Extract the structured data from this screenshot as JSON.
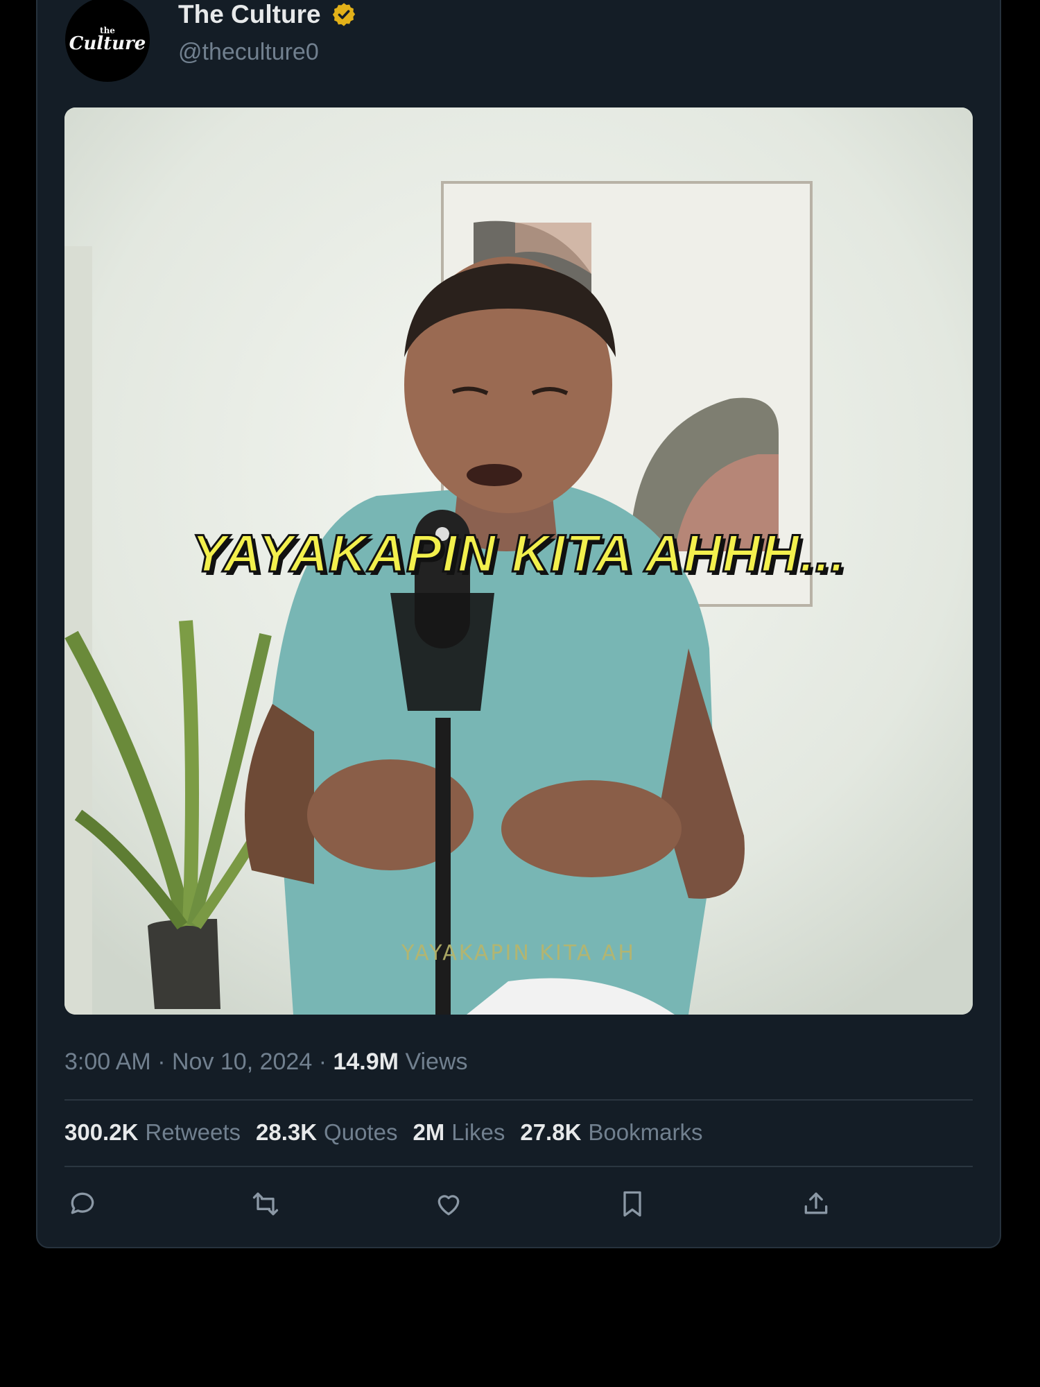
{
  "tweet": {
    "author": {
      "display_name": "The Culture",
      "handle": "@theculture0",
      "avatar_text_top": "the",
      "avatar_text_main": "Culture",
      "verified_badge_icon": "verified-badge-icon",
      "verified_color": "#e2b119"
    },
    "media": {
      "caption_main": "YAYAKAPIN KITA AHHH...",
      "caption_sub": "YAYAKAPIN KITA AH"
    },
    "meta": {
      "time": "3:00 AM",
      "date": "Nov 10, 2024",
      "separator": "·",
      "views_count": "14.9M",
      "views_label": "Views"
    },
    "stats": [
      {
        "count": "300.2K",
        "label": "Retweets"
      },
      {
        "count": "28.3K",
        "label": "Quotes"
      },
      {
        "count": "2M",
        "label": "Likes"
      },
      {
        "count": "27.8K",
        "label": "Bookmarks"
      }
    ],
    "actions": [
      {
        "icon": "reply-icon"
      },
      {
        "icon": "retweet-icon"
      },
      {
        "icon": "like-icon"
      },
      {
        "icon": "bookmark-icon"
      },
      {
        "icon": "share-icon"
      }
    ]
  },
  "colors": {
    "background": "#000000",
    "card": "#141d26",
    "primary_text": "#e7e9ea",
    "secondary_text": "#71808f",
    "caption_yellow": "#f3f04d"
  }
}
